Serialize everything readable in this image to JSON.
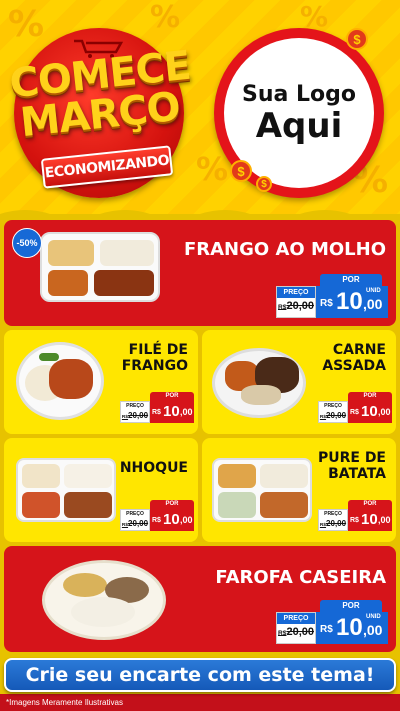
{
  "header": {
    "headline_line1": "COMECE",
    "headline_line2": "MARÇO",
    "subheadline": "ECONOMIZANDO",
    "logo_line1": "Sua Logo",
    "logo_line2": "Aqui",
    "coin_symbol": "$",
    "background_symbol": "%"
  },
  "items": [
    {
      "name": "FRANGO AO MOLHO",
      "discount": "-50%",
      "por_label": "POR",
      "preco_label": "PREÇO",
      "old_prefix": "R$",
      "old_price": "20,00",
      "currency": "R$",
      "price_int": "10",
      "price_dec": ",00",
      "unit": "UNID"
    },
    {
      "name_line1": "FILÉ DE",
      "name_line2": "FRANGO",
      "por_label": "POR",
      "preco_label": "PREÇO",
      "old_prefix": "R$",
      "old_price": "20,00",
      "currency": "R$",
      "price_int": "10",
      "price_dec": ",00"
    },
    {
      "name_line1": "CARNE",
      "name_line2": "ASSADA",
      "por_label": "POR",
      "preco_label": "PREÇO",
      "old_prefix": "R$",
      "old_price": "20,00",
      "currency": "R$",
      "price_int": "10",
      "price_dec": ",00"
    },
    {
      "name": "NHOQUE",
      "por_label": "POR",
      "preco_label": "PREÇO",
      "old_prefix": "R$",
      "old_price": "20,00",
      "currency": "R$",
      "price_int": "10",
      "price_dec": ",00"
    },
    {
      "name_line1": "PURE DE",
      "name_line2": "BATATA",
      "por_label": "POR",
      "preco_label": "PREÇO",
      "old_prefix": "R$",
      "old_price": "20,00",
      "currency": "R$",
      "price_int": "10",
      "price_dec": ",00"
    },
    {
      "name": "FAROFA CASEIRA",
      "por_label": "POR",
      "preco_label": "PREÇO",
      "old_prefix": "R$",
      "old_price": "20,00",
      "currency": "R$",
      "price_int": "10",
      "price_dec": ",00",
      "unit": "UNID"
    }
  ],
  "footer": {
    "cta_label": "Crie seu encarte com este tema!",
    "disclaimer": "*Imagens Meramente Ilustrativas"
  },
  "colors": {
    "red": "#d6141a",
    "yellow": "#ffe600",
    "blue": "#1568d6",
    "gold_text": "#ffd21a"
  },
  "icons": [
    "shopping-cart-icon",
    "coin-icon"
  ]
}
